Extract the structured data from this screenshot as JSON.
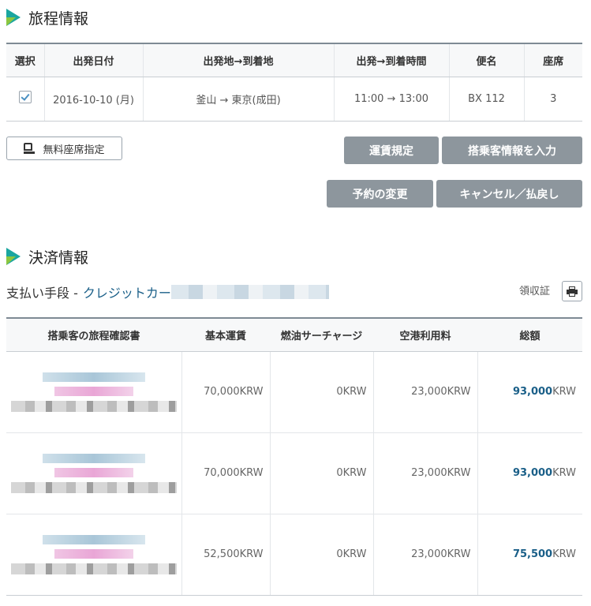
{
  "itinerary": {
    "title": "旅程情報",
    "headers": [
      "選択",
      "出発日付",
      "出発地→到着地",
      "出発→到着時間",
      "便名",
      "座席"
    ],
    "row": {
      "date": "2016-10-10 (月)",
      "route": "釜山 → 東京(成田)",
      "time": "11:00 → 13:00",
      "flight": "BX 112",
      "seats": "3"
    },
    "buttons": {
      "free_seat": "無料座席指定",
      "fare_rules": "運賃規定",
      "passenger_info": "搭乗客情報を入力",
      "change_booking": "予約の変更",
      "cancel_refund": "キャンセル／払戻し"
    }
  },
  "payment": {
    "title": "決済情報",
    "method_label": "支払い手段 -",
    "method_value": "クレジットカー",
    "receipt_label": "領収証",
    "headers": [
      "搭乗客の旅程確認書",
      "基本運賃",
      "燃油サーチャージ",
      "空港利用料",
      "総額"
    ],
    "rows": [
      {
        "base": "70,000KRW",
        "fuel": "0KRW",
        "airport": "23,000KRW",
        "total_num": "93,000",
        "total_cur": "KRW"
      },
      {
        "base": "70,000KRW",
        "fuel": "0KRW",
        "airport": "23,000KRW",
        "total_num": "93,000",
        "total_cur": "KRW"
      },
      {
        "base": "52,500KRW",
        "fuel": "0KRW",
        "airport": "23,000KRW",
        "total_num": "75,500",
        "total_cur": "KRW"
      }
    ]
  },
  "colors": {
    "accent_teal": "#1aa6a0",
    "accent_green": "#8cc63f",
    "link_blue": "#1a5f88",
    "button_gray": "#8d969d"
  }
}
